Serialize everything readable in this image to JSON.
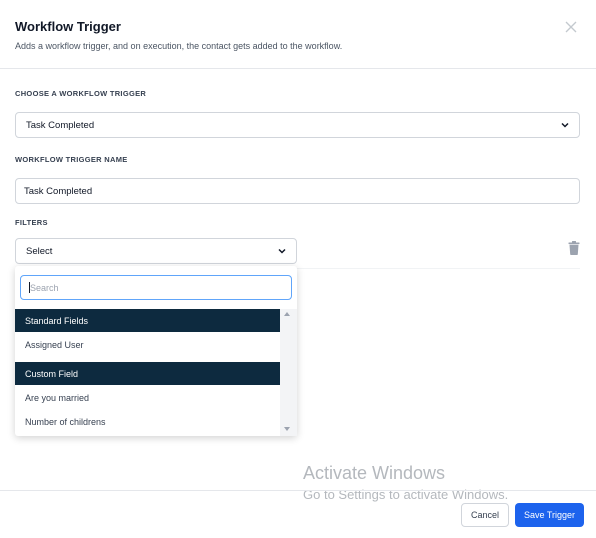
{
  "header": {
    "title": "Workflow Trigger",
    "subtitle": "Adds a workflow trigger, and on execution, the contact gets added to the workflow."
  },
  "icons": {
    "close": "close-icon",
    "chevron": "chevron-down-icon",
    "trash": "trash-icon"
  },
  "trigger": {
    "label": "CHOOSE A WORKFLOW TRIGGER",
    "value": "Task Completed"
  },
  "trigger_name": {
    "label": "WORKFLOW TRIGGER NAME",
    "value": "Task Completed"
  },
  "filters": {
    "label": "FILTERS",
    "select_value": "Select"
  },
  "dropdown": {
    "search_placeholder": "Search",
    "groups": [
      {
        "label": "Standard Fields",
        "options": [
          "Assigned User"
        ]
      },
      {
        "label": "Custom Field",
        "options": [
          "Are you married",
          "Number of childrens"
        ]
      }
    ]
  },
  "watermark": {
    "line1": "Activate Windows",
    "line2": "Go to Settings to activate Windows."
  },
  "footer": {
    "cancel_label": "Cancel",
    "save_label": "Save Trigger"
  },
  "colors": {
    "primary": "#1d63ed",
    "group_header": "#0d2a3f",
    "focus_border": "#60a5fa"
  }
}
